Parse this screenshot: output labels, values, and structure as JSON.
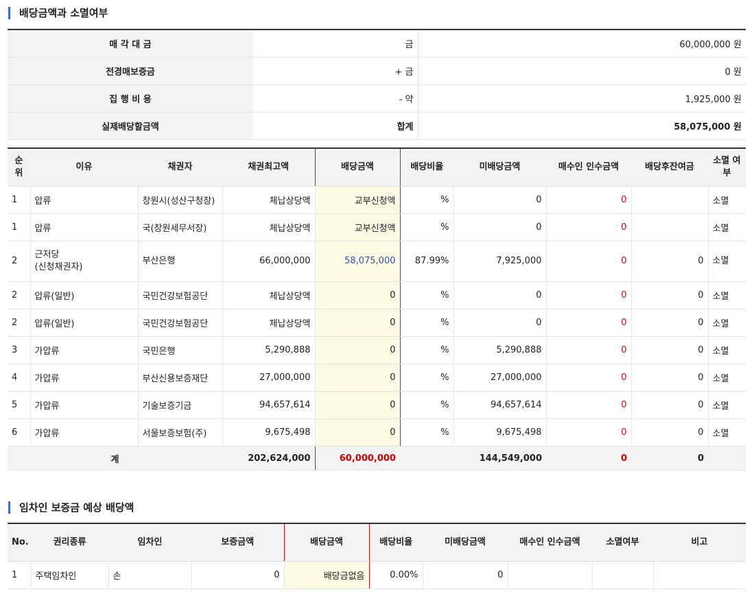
{
  "section1_title": "배당금액과 소멸여부",
  "summary": [
    {
      "label": "매 각 대 금",
      "sign": "금",
      "amount": "60,000,000 원"
    },
    {
      "label": "전경매보증금",
      "sign": "+ 금",
      "amount": "0 원"
    },
    {
      "label": "집 행 비 용",
      "sign": "- 약",
      "amount": "1,925,000 원"
    },
    {
      "label": "실제배당할금액",
      "sign": "합계",
      "amount": "58,075,000 원"
    }
  ],
  "dist_headers": {
    "rank": "순위",
    "reason": "이유",
    "creditor": "채권자",
    "max_claim": "채권최고액",
    "dividend": "배당금액",
    "ratio": "배당비율",
    "undistributed": "미배당금액",
    "buyer_assume": "매수인 인수금액",
    "remaining": "배당후잔여금",
    "extinct": "소멸 여부"
  },
  "dist_rows": [
    {
      "rank": "1",
      "reason": "압류",
      "creditor": "창원시(성산구청장)",
      "max_claim": "체납상당액",
      "dividend": "교부신청액",
      "ratio": "%",
      "undistributed": "0",
      "buyer_assume": "0",
      "remaining": "",
      "extinct": "소멸"
    },
    {
      "rank": "1",
      "reason": "압류",
      "creditor": "국(창원세무서장)",
      "max_claim": "체납상당액",
      "dividend": "교부신청액",
      "ratio": "%",
      "undistributed": "0",
      "buyer_assume": "0",
      "remaining": "",
      "extinct": "소멸"
    },
    {
      "rank": "2",
      "reason": "근저당\n(신청채권자)",
      "creditor": "부산은행",
      "max_claim": "66,000,000",
      "dividend": "58,075,000",
      "ratio": "87.99%",
      "undistributed": "7,925,000",
      "buyer_assume": "0",
      "remaining": "0",
      "extinct": "소멸"
    },
    {
      "rank": "2",
      "reason": "압류(일반)",
      "creditor": "국민건강보험공단",
      "max_claim": "체납상당액",
      "dividend": "0",
      "ratio": "%",
      "undistributed": "0",
      "buyer_assume": "0",
      "remaining": "0",
      "extinct": "소멸"
    },
    {
      "rank": "2",
      "reason": "압류(일반)",
      "creditor": "국민건강보험공단",
      "max_claim": "체납상당액",
      "dividend": "0",
      "ratio": "%",
      "undistributed": "0",
      "buyer_assume": "0",
      "remaining": "0",
      "extinct": "소멸"
    },
    {
      "rank": "3",
      "reason": "가압류",
      "creditor": "국민은행",
      "max_claim": "5,290,888",
      "dividend": "0",
      "ratio": "%",
      "undistributed": "5,290,888",
      "buyer_assume": "0",
      "remaining": "0",
      "extinct": "소멸"
    },
    {
      "rank": "4",
      "reason": "가압류",
      "creditor": "부산신용보증재단",
      "max_claim": "27,000,000",
      "dividend": "0",
      "ratio": "%",
      "undistributed": "27,000,000",
      "buyer_assume": "0",
      "remaining": "0",
      "extinct": "소멸"
    },
    {
      "rank": "5",
      "reason": "가압류",
      "creditor": "기술보증기금",
      "max_claim": "94,657,614",
      "dividend": "0",
      "ratio": "%",
      "undistributed": "94,657,614",
      "buyer_assume": "0",
      "remaining": "0",
      "extinct": "소멸"
    },
    {
      "rank": "6",
      "reason": "가압류",
      "creditor": "서울보증보험(주)",
      "max_claim": "9,675,498",
      "dividend": "0",
      "ratio": "%",
      "undistributed": "9,675,498",
      "buyer_assume": "0",
      "remaining": "0",
      "extinct": "소멸"
    }
  ],
  "dist_total": {
    "label": "계",
    "max_claim": "202,624,000",
    "dividend": "60,000,000",
    "undistributed": "144,549,000",
    "buyer_assume": "0",
    "remaining": "0"
  },
  "section2_title": "임차인 보증금 예상 배당액",
  "tenant_headers": {
    "no": "No.",
    "right_type": "권리종류",
    "tenant": "임차인",
    "deposit": "보증금액",
    "dividend": "배당금액",
    "ratio": "배당비율",
    "undistributed": "미배당금액",
    "buyer_assume": "매수인 인수금액",
    "extinct": "소멸여부",
    "note": "비고"
  },
  "tenant_rows": [
    {
      "no": "1",
      "right_type": "주택임차인",
      "tenant": "손",
      "deposit": "0",
      "dividend": "배당금없음",
      "ratio": "0.00%",
      "undistributed": "0",
      "buyer_assume": "",
      "extinct": "",
      "note": ""
    }
  ],
  "colors": {
    "accent_bar": "#3b6bd6",
    "red_value": "#d40000",
    "blue_value": "#3a4ea8",
    "pay_bg": "#fdfbe3"
  }
}
